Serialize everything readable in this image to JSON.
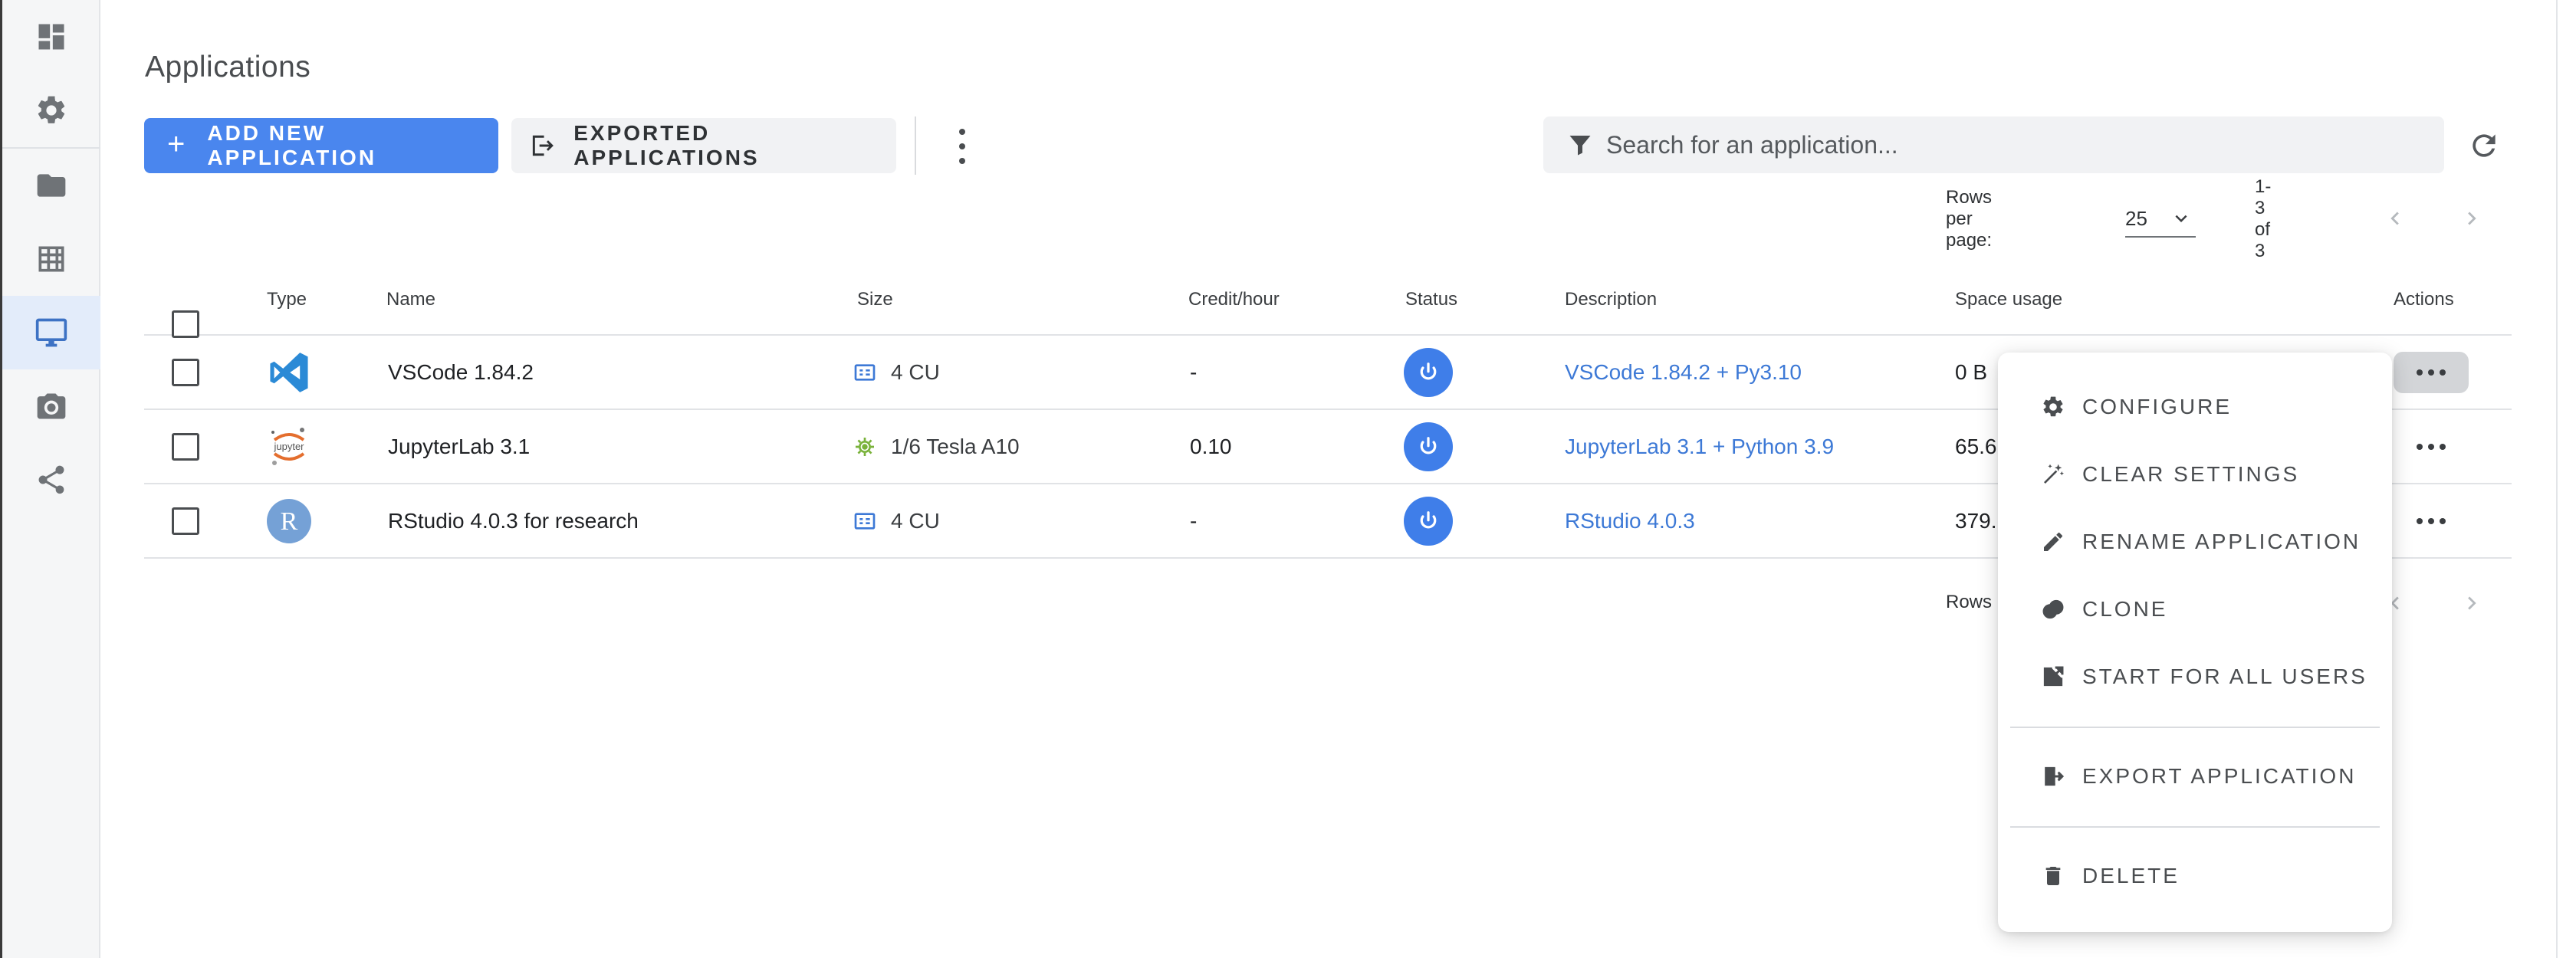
{
  "sidebar": {
    "items": [
      {
        "icon": "dashboard-icon"
      },
      {
        "icon": "gear-icon"
      },
      {
        "icon": "folder-icon"
      },
      {
        "icon": "table-icon"
      },
      {
        "icon": "monitor-icon",
        "active": true
      },
      {
        "icon": "camera-icon"
      },
      {
        "icon": "share-icon"
      }
    ]
  },
  "page": {
    "title": "Applications"
  },
  "toolbar": {
    "add_label": "ADD NEW APPLICATION",
    "add_icon": "+",
    "exported_label": "EXPORTED APPLICATIONS"
  },
  "search": {
    "placeholder": "Search for an application..."
  },
  "pagination": {
    "rows_per_page_label": "Rows per page:",
    "rows_per_page_value": "25",
    "range": "1-3 of 3",
    "footer_rows_label": "Rows p"
  },
  "table": {
    "columns": [
      "Type",
      "Name",
      "Size",
      "Credit/hour",
      "Status",
      "Description",
      "Space usage",
      "Actions"
    ],
    "rows": [
      {
        "type_icon": "vscode-icon",
        "name": "VSCode 1.84.2",
        "size_icon": "cpu-icon",
        "size": "4 CU",
        "credit": "-",
        "description": "VSCode 1.84.2 + Py3.10",
        "space": "0 B"
      },
      {
        "type_icon": "jupyter-icon",
        "name": "JupyterLab 3.1",
        "size_icon": "gpu-icon",
        "size": "1/6 Tesla A10",
        "credit": "0.10",
        "description": "JupyterLab 3.1 + Python 3.9",
        "space": "65.6"
      },
      {
        "type_icon": "rstudio-icon",
        "name": "RStudio 4.0.3 for research",
        "size_icon": "cpu-icon",
        "size": "4 CU",
        "credit": "-",
        "description": "RStudio 4.0.3",
        "space": "379."
      }
    ],
    "jupyter_logo_text": "jupyter",
    "rstudio_logo_text": "R"
  },
  "menu": {
    "items": [
      {
        "label": "CONFIGURE",
        "icon": "gear-icon"
      },
      {
        "label": "CLEAR SETTINGS",
        "icon": "magic-wand-icon"
      },
      {
        "label": "RENAME APPLICATION",
        "icon": "pencil-icon"
      },
      {
        "label": "CLONE",
        "icon": "clone-icon"
      },
      {
        "label": "START FOR ALL USERS",
        "icon": "open-external-icon"
      },
      {
        "label": "EXPORT APPLICATION",
        "icon": "export-icon"
      },
      {
        "label": "DELETE",
        "icon": "trash-icon"
      }
    ]
  },
  "colors": {
    "accent": "#4a86ee",
    "link": "#3d79d6",
    "power": "#3f7ee9"
  }
}
